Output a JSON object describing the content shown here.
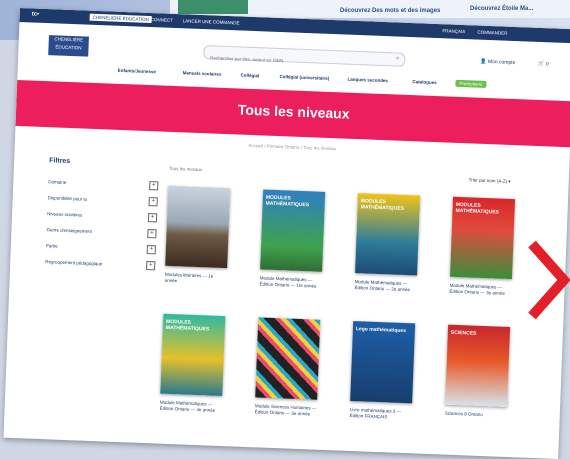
{
  "background": {
    "banner_left": "",
    "banner_texts": [
      "Découvrez Des mots et des images",
      "Découvrez Étoile Ma..."
    ]
  },
  "topbar": {
    "logo": "tc•",
    "tabs": [
      "CHENELIERE ÉDUCATION",
      "CONNECT",
      "LANCER UNE COMMANDE"
    ],
    "right_links": [
      "FRANÇAIS",
      "COMMANDER"
    ]
  },
  "header": {
    "logo_text": "CHENELIÈRE ÉDUCATION",
    "search_placeholder": "Rechercher par titre, auteur ou ISBN",
    "account_label": "Mon compte",
    "cart_label": "0"
  },
  "nav": {
    "items": [
      "Enfants/Jeunesse",
      "Manuels scolaires",
      "Collégial",
      "Collégial (universitaire)",
      "Langues secondes",
      "Catalogues"
    ],
    "promo": "Promotions"
  },
  "hero": {
    "title": "Tous les niveaux"
  },
  "breadcrumb": "Accueil / Primaire Ontario / Tous les niveaux",
  "filters": {
    "title": "Filtres",
    "items": [
      "Domaine",
      "Disponibilité pour la",
      "Niveaux scolaires",
      "Genre d'enseignement",
      "Partie",
      "Regroupement pédagogique"
    ]
  },
  "results": {
    "count": "Tous les niveaux",
    "sort": "Trier par nom (A-Z) ▾"
  },
  "books": [
    {
      "title": "Modules littéraires — 1e année",
      "cover_text": "",
      "color": "#8a6a4e"
    },
    {
      "title": "Module Mathématiques — Édition Ontario — 1re année",
      "cover_text": "MODULES MATHÉMATIQUES",
      "color": "#2e7fc2"
    },
    {
      "title": "Module Mathématiques — Édition Ontario — 2e année",
      "cover_text": "MODULES MATHÉMATIQUES",
      "color": "#f1c418"
    },
    {
      "title": "Module Mathématiques — Édition Ontario — 3e année",
      "cover_text": "MODULES MATHÉMATIQUES",
      "color": "#d9262c"
    },
    {
      "title": "Module Mathématiques — Édition Ontario — 4e année",
      "cover_text": "MODULES MATHÉMATIQUES",
      "color": "#2fb9a0"
    },
    {
      "title": "Module Sciences Humaines — Édition Ontario — 5e année",
      "cover_text": "",
      "color": "#222222"
    },
    {
      "title": "Livre mathématiques 3 — Édition FRANÇAIS",
      "cover_text": "Lego mathématiques",
      "color": "#1e5ea8"
    },
    {
      "title": "Sciences 8 Ontario",
      "cover_text": "SCIENCES",
      "color": "#c8262c"
    }
  ]
}
